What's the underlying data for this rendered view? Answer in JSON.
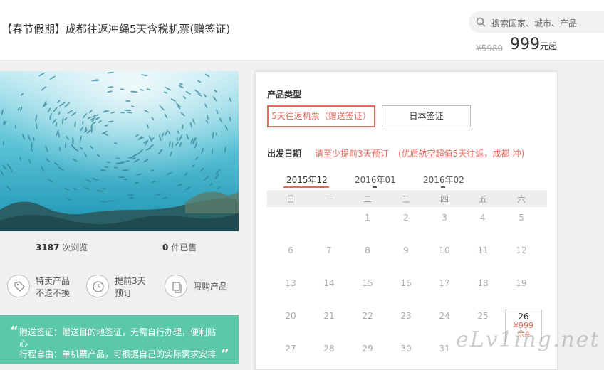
{
  "header": {
    "title": "【春节假期】成都往返冲绳5天含税机票(赠签证)",
    "search_placeholder": "搜索国家、城市、产品",
    "original_price": "¥5980",
    "price": "999",
    "price_unit": "元起"
  },
  "stats": {
    "views_count": "3187",
    "views_label": "次浏览",
    "sold_count": "0",
    "sold_label": "件已售"
  },
  "features": [
    {
      "icon": "tag-icon",
      "line1": "特卖产品",
      "line2": "不退不换"
    },
    {
      "icon": "clock-icon",
      "line1": "提前3天",
      "line2": "预订"
    },
    {
      "icon": "copy-icon",
      "line1": "限购产品",
      "line2": ""
    }
  ],
  "promo": {
    "open_quote": "“",
    "close_quote": "”",
    "line1": "赠送签证：赠送目的地签证，无需自行办理，便利贴",
    "line1b": "心",
    "line2": "行程自由：单机票产品，可根据自己的实际需求安排"
  },
  "booking": {
    "product_type_label": "产品类型",
    "options": [
      "5天往返机票（赠送签证）",
      "日本签证"
    ],
    "selected_option": 0,
    "departure_label": "出发日期",
    "advance_notice": "请至少提前3天预订",
    "route_note": "(优质航空超值5天往返，成都-冲)",
    "months": [
      "2015年12",
      "2016年01",
      "2016年02"
    ],
    "active_month": 0,
    "weekdays": [
      "日",
      "一",
      "二",
      "三",
      "四",
      "五",
      "六"
    ],
    "weeks": [
      [
        "",
        "",
        "1",
        "2",
        "3",
        "4",
        "5"
      ],
      [
        "6",
        "7",
        "8",
        "9",
        "10",
        "11",
        "12"
      ],
      [
        "13",
        "14",
        "15",
        "16",
        "17",
        "18",
        "19"
      ],
      [
        "20",
        "21",
        "22",
        "23",
        "24",
        "25",
        "26"
      ],
      [
        "27",
        "28",
        "29",
        "30",
        "31",
        "",
        ""
      ]
    ],
    "available_day": {
      "day": "26",
      "price": "¥999",
      "stock": "余4"
    }
  },
  "watermark": "eLv1ing.net",
  "colors": {
    "accent": "#e8685b",
    "promo_bg": "#5bc9a8"
  }
}
